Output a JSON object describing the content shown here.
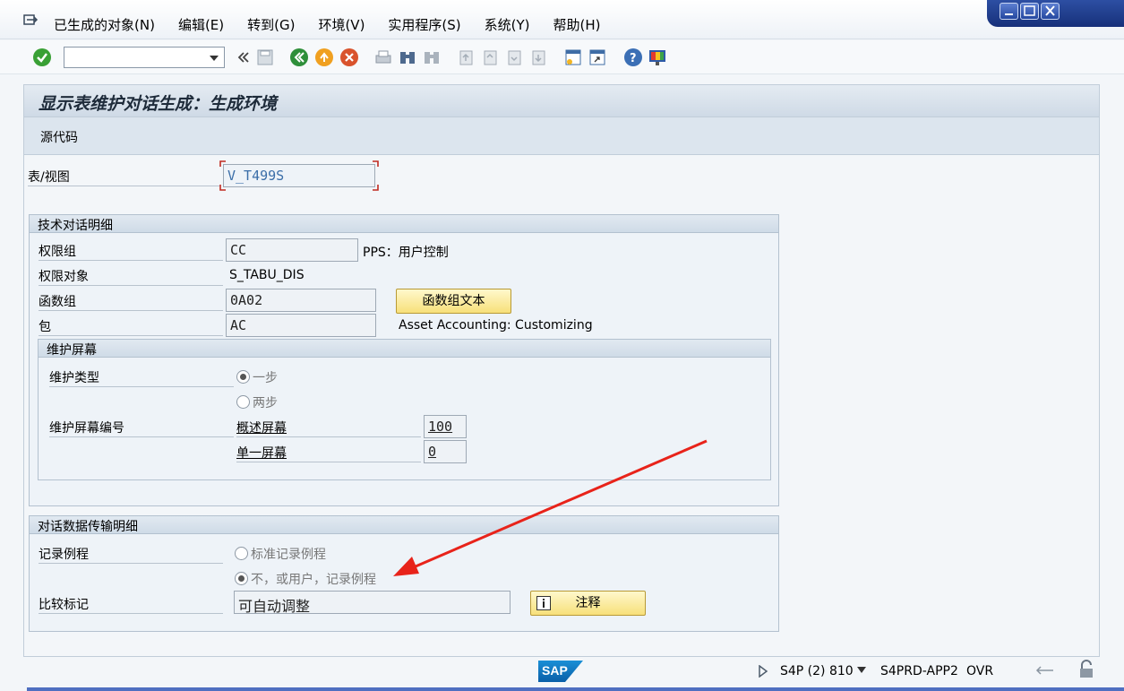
{
  "menu": {
    "items": [
      "已生成的对象(N)",
      "编辑(E)",
      "转到(G)",
      "环境(V)",
      "实用程序(S)",
      "系统(Y)",
      "帮助(H)"
    ]
  },
  "toolbar": {
    "command_field_value": ""
  },
  "screen": {
    "title": "显示表维护对话生成：生成环境",
    "app_button": "源代码"
  },
  "table_view": {
    "label": "表/视图",
    "value": "V_T499S"
  },
  "tech_details": {
    "header": "技术对话明细",
    "auth_group_label": "权限组",
    "auth_group_value": "CC",
    "auth_group_text": "PPS：用户控制",
    "auth_object_label": "权限对象",
    "auth_object_value": "S_TABU_DIS",
    "function_group_label": "函数组",
    "function_group_value": "0A02",
    "function_group_button": "函数组文本",
    "package_label": "包",
    "package_value": "AC",
    "package_text": "Asset Accounting: Customizing"
  },
  "maint_screen": {
    "header": "维护屏幕",
    "type_label": "维护类型",
    "option_one_step": "一步",
    "option_two_step": "两步",
    "screen_number_label": "维护屏幕编号",
    "overview_label": "概述屏幕",
    "overview_value": "100",
    "single_label": "单一屏幕",
    "single_value": "0"
  },
  "transport": {
    "header": "对话数据传输明细",
    "record_routine_label": "记录例程",
    "option_standard": "标准记录例程",
    "option_none": "不，或用户，记录例程",
    "compare_label": "比较标记",
    "compare_value": "可自动调整",
    "note_button": "注释"
  },
  "status": {
    "system": "S4P (2) 810",
    "server": "S4PRD-APP2",
    "mode": "OVR"
  },
  "colors": {
    "accent_arrow": "#e8231a",
    "button_yellow": "#f7e07a",
    "title_bar": "#cfdae6"
  }
}
